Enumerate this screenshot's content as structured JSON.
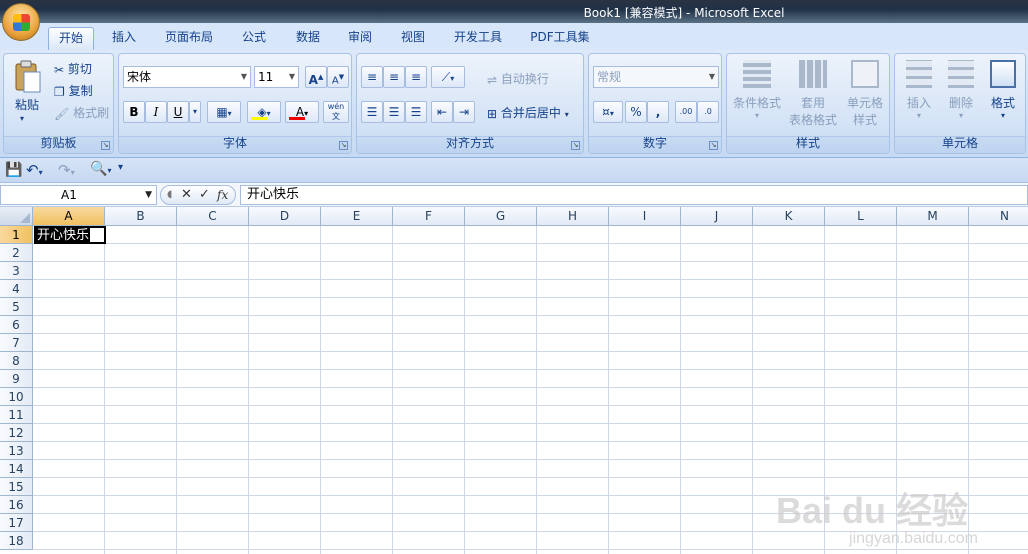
{
  "window": {
    "title": "Book1  [兼容模式] - Microsoft Excel"
  },
  "tabs": [
    {
      "label": "开始",
      "active": true
    },
    {
      "label": "插入"
    },
    {
      "label": "页面布局"
    },
    {
      "label": "公式"
    },
    {
      "label": "数据"
    },
    {
      "label": "审阅"
    },
    {
      "label": "视图"
    },
    {
      "label": "开发工具"
    },
    {
      "label": "PDF工具集"
    }
  ],
  "clipboard": {
    "group": "剪贴板",
    "paste": "粘贴",
    "cut": "剪切",
    "copy": "复制",
    "format_painter": "格式刷"
  },
  "font": {
    "group": "字体",
    "name": "宋体",
    "size": "11",
    "bold": "B",
    "italic": "I",
    "underline": "U",
    "grow": "A",
    "shrink": "A",
    "color_letter": "A",
    "phonetic": "wén"
  },
  "alignment": {
    "group": "对齐方式",
    "wrap": "自动换行",
    "merge": "合并后居中"
  },
  "number": {
    "group": "数字",
    "format": "常规",
    "percent": "%",
    "comma": ","
  },
  "styles": {
    "group": "样式",
    "conditional": "条件格式",
    "table_format_1": "套用",
    "table_format_2": "表格格式",
    "cell_style_1": "单元格",
    "cell_style_2": "样式"
  },
  "cells": {
    "group": "单元格",
    "insert": "插入",
    "delete": "删除",
    "format": "格式"
  },
  "formula_bar": {
    "name_box": "A1",
    "fx": "fx",
    "content": "开心快乐"
  },
  "columns": [
    "A",
    "B",
    "C",
    "D",
    "E",
    "F",
    "G",
    "H",
    "I",
    "J",
    "K",
    "L",
    "M",
    "N"
  ],
  "rows": [
    "1",
    "2",
    "3",
    "4",
    "5",
    "6",
    "7",
    "8",
    "9",
    "10",
    "11",
    "12",
    "13",
    "14",
    "15",
    "16",
    "17",
    "18"
  ],
  "cell_a1": "开心快乐",
  "watermark": {
    "main": "Bai du 经验",
    "sub": "jingyan.baidu.com"
  }
}
